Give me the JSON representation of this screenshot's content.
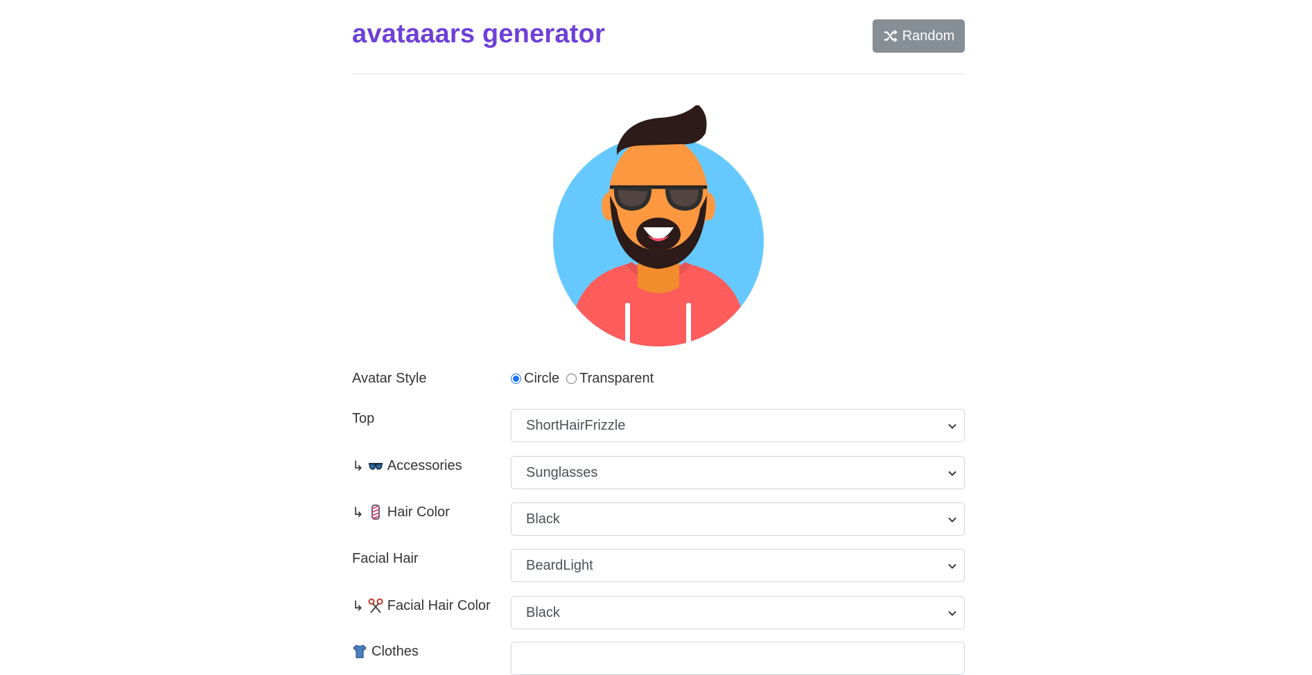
{
  "header": {
    "title": "avataaars generator",
    "random_button_label": "Random",
    "random_icon": "shuffle-icon"
  },
  "avatar": {
    "background_color": "#65C9FF",
    "skin_color": "#FD9841",
    "hair_color": "#2C1B18",
    "clothes_color": "#FF5C5C",
    "icon": "avatar-preview"
  },
  "form": {
    "avatar_style": {
      "label": "Avatar Style",
      "options": [
        "Circle",
        "Transparent"
      ],
      "selected": "Circle"
    },
    "rows": [
      {
        "label": "Top",
        "prefix": "",
        "emoji": "",
        "value": "ShortHairFrizzle"
      },
      {
        "label": "Accessories",
        "prefix": "↳",
        "emoji": "sunglasses-emoji",
        "value": "Sunglasses"
      },
      {
        "label": "Hair Color",
        "prefix": "↳",
        "emoji": "barber-pole-emoji",
        "value": "Black"
      },
      {
        "label": "Facial Hair",
        "prefix": "",
        "emoji": "",
        "value": "BeardLight"
      },
      {
        "label": "Facial Hair Color",
        "prefix": "↳",
        "emoji": "scissors-emoji",
        "value": "Black"
      },
      {
        "label": "Clothes",
        "prefix": "",
        "emoji": "shirt-emoji",
        "value": ""
      }
    ]
  }
}
